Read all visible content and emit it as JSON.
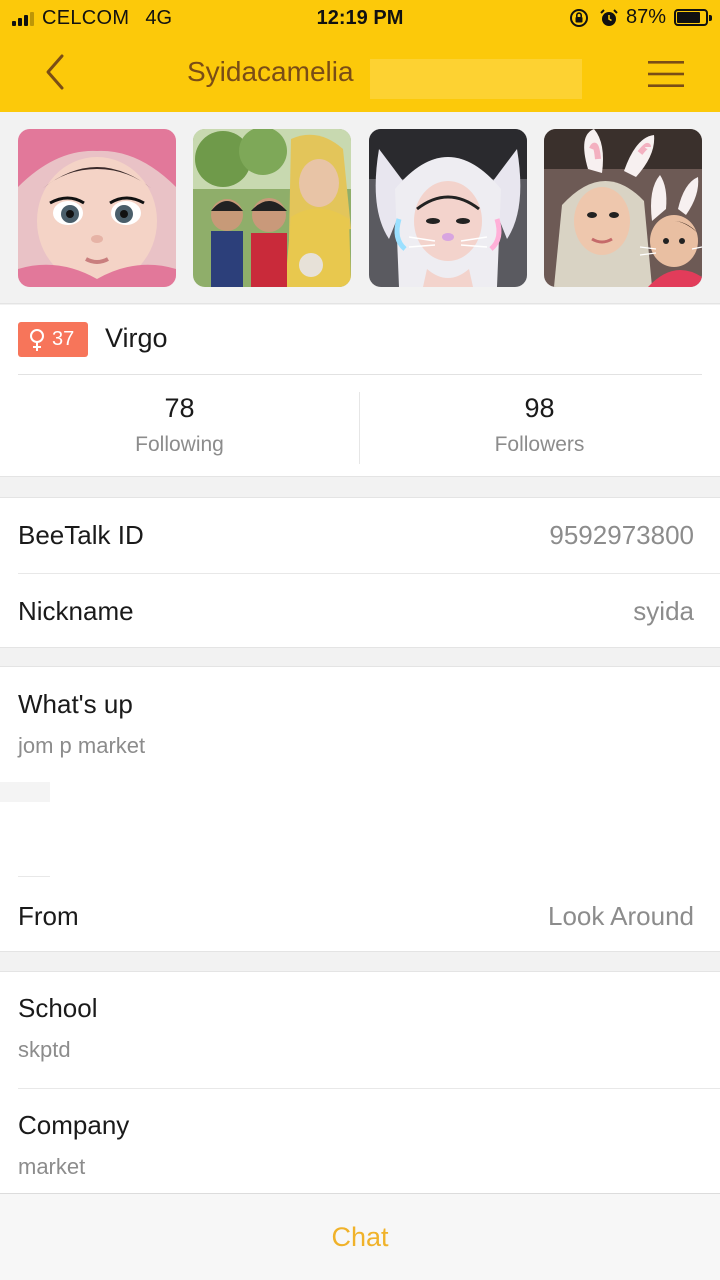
{
  "status_bar": {
    "carrier": "CELCOM",
    "network": "4G",
    "time": "12:19 PM",
    "battery": "87%",
    "battery_level": 0.87,
    "signal_bars": 3,
    "signal_bars_total": 4
  },
  "nav": {
    "title": "Syidacamelia",
    "back_icon": "chevron-left-icon",
    "menu_icon": "hamburger-menu-icon"
  },
  "photos": [
    {
      "name": "photo-1"
    },
    {
      "name": "photo-2"
    },
    {
      "name": "photo-3"
    },
    {
      "name": "photo-4"
    }
  ],
  "profile": {
    "gender_icon": "female-icon",
    "age": "37",
    "zodiac": "Virgo",
    "following_count": "78",
    "following_label": "Following",
    "followers_count": "98",
    "followers_label": "Followers"
  },
  "info": {
    "beetalk_id_label": "BeeTalk ID",
    "beetalk_id_value": "9592973800",
    "nickname_label": "Nickname",
    "nickname_value": "syida",
    "whatsup_label": "What's up",
    "whatsup_value": "jom p market",
    "from_label": "From",
    "from_value": "Look Around",
    "school_label": "School",
    "school_value": "skptd",
    "company_label": "Company",
    "company_value": "market"
  },
  "chat": {
    "label": "Chat"
  },
  "colors": {
    "header_bg": "#fcc90a",
    "title_text": "#7a4d16",
    "badge_bg": "#f7755a",
    "chat_text": "#f0b22a",
    "secondary_text": "#8c8c8c"
  }
}
